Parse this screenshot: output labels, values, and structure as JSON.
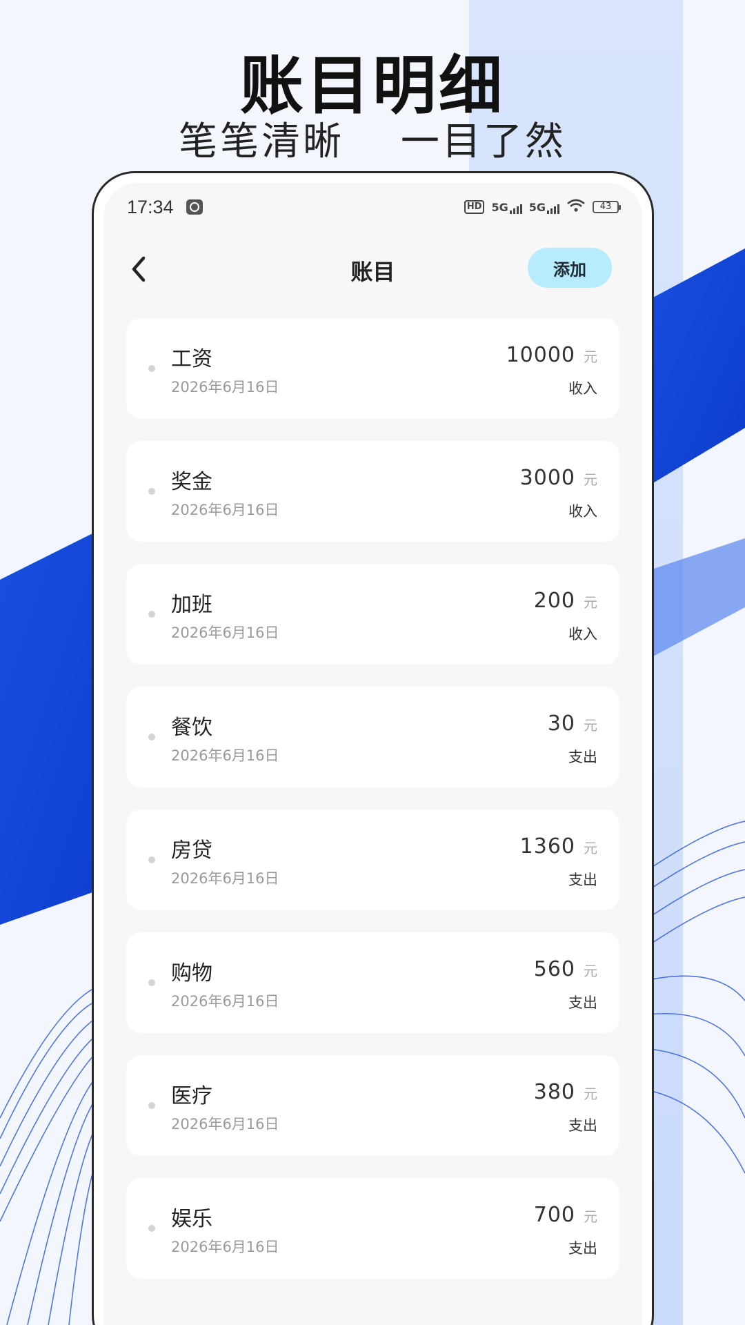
{
  "promo": {
    "headline": "账目明细",
    "sub_left": "笔笔清晰",
    "sub_right": "一目了然"
  },
  "status_bar": {
    "time": "17:34",
    "network_1": "5G",
    "network_2": "5G",
    "hd_label": "HD",
    "battery": "43"
  },
  "nav": {
    "title": "账目",
    "add_label": "添加"
  },
  "currency_unit": "元",
  "entries": [
    {
      "title": "工资",
      "date": "2026年6月16日",
      "amount": "10000",
      "type": "收入"
    },
    {
      "title": "奖金",
      "date": "2026年6月16日",
      "amount": "3000",
      "type": "收入"
    },
    {
      "title": "加班",
      "date": "2026年6月16日",
      "amount": "200",
      "type": "收入"
    },
    {
      "title": "餐饮",
      "date": "2026年6月16日",
      "amount": "30",
      "type": "支出"
    },
    {
      "title": "房贷",
      "date": "2026年6月16日",
      "amount": "1360",
      "type": "支出"
    },
    {
      "title": "购物",
      "date": "2026年6月16日",
      "amount": "560",
      "type": "支出"
    },
    {
      "title": "医疗",
      "date": "2026年6月16日",
      "amount": "380",
      "type": "支出"
    },
    {
      "title": "娱乐",
      "date": "2026年6月16日",
      "amount": "700",
      "type": "支出"
    }
  ],
  "colors": {
    "accent_blue": "#1446d8",
    "add_button_bg": "#b6ecfb",
    "page_bg": "#f3f7fd"
  }
}
